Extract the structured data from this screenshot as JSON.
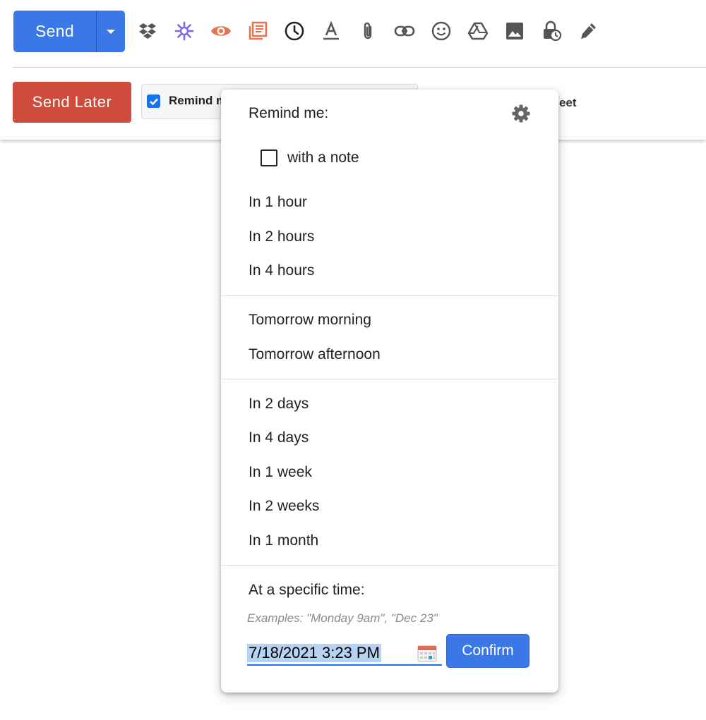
{
  "toolbar": {
    "send_label": "Send",
    "icons": [
      {
        "name": "dropbox-icon",
        "color": "#555555"
      },
      {
        "name": "sparkle-icon",
        "color": "#7b68ee"
      },
      {
        "name": "eye-icon",
        "color": "#e8734a"
      },
      {
        "name": "templates-icon",
        "color": "#e8734a"
      },
      {
        "name": "clock-icon",
        "color": "#222222"
      },
      {
        "name": "text-format-icon",
        "color": "#555555"
      },
      {
        "name": "attachment-icon",
        "color": "#555555"
      },
      {
        "name": "link-icon",
        "color": "#555555"
      },
      {
        "name": "emoji-icon",
        "color": "#555555"
      },
      {
        "name": "drive-icon",
        "color": "#555555"
      },
      {
        "name": "image-icon",
        "color": "#555555"
      },
      {
        "name": "confidential-mode-icon",
        "color": "#555555"
      },
      {
        "name": "signature-pen-icon",
        "color": "#555555"
      }
    ],
    "colors": {
      "send": "#3b78e7",
      "send_later": "#cf4c3c"
    }
  },
  "options_bar": {
    "send_later_label": "Send Later",
    "remind_label": "Remind m",
    "remind_checked": true,
    "meet_partial_label": "eet"
  },
  "menu": {
    "title": "Remind me:",
    "note_label": "with a note",
    "note_checked": false,
    "items": [
      "In 1 hour",
      "In 2 hours",
      "In 4 hours",
      "Tomorrow morning",
      "Tomorrow afternoon",
      "In 2 days",
      "In 4 days",
      "In 1 week",
      "In 2 weeks",
      "In 1 month"
    ],
    "specific_label": "At a specific time:",
    "examples": "Examples: \"Monday 9am\", \"Dec 23\"",
    "date_value": "7/18/2021 3:23 PM",
    "confirm_label": "Confirm"
  }
}
